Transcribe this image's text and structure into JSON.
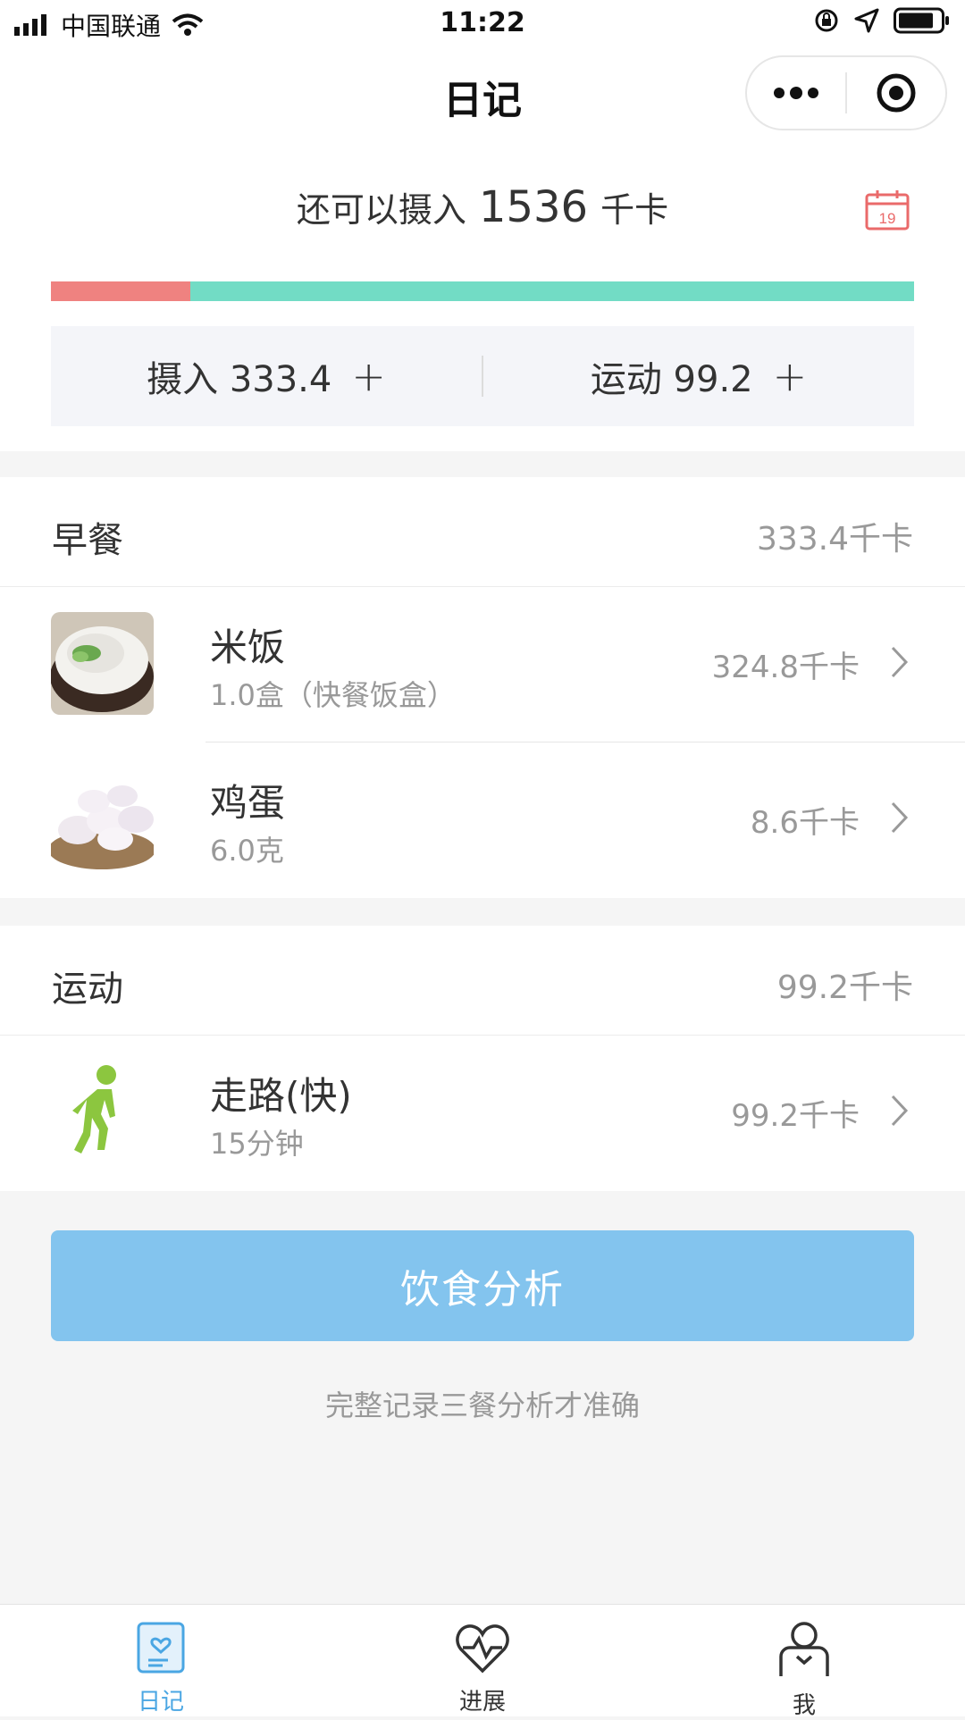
{
  "status_bar": {
    "carrier": "中国联通",
    "time": "11:22"
  },
  "nav": {
    "title": "日记",
    "more_icon": "more-dots-icon",
    "target_icon": "target-icon"
  },
  "summary": {
    "remaining_prefix": "还可以摄入",
    "remaining_value": "1536",
    "remaining_unit": "千卡",
    "calendar_day": "19",
    "progress_intake_fraction": 0.162,
    "colors": {
      "intake": "#ef8280",
      "remaining": "#72dcc5"
    },
    "intake_label": "摄入 333.4",
    "exercise_label": "运动 99.2",
    "plus": "+"
  },
  "breakfast": {
    "title": "早餐",
    "total": "333.4千卡",
    "items": [
      {
        "name": "米饭",
        "detail": "1.0盒（快餐饭盒）",
        "kcal": "324.8千卡"
      },
      {
        "name": "鸡蛋",
        "detail": "6.0克",
        "kcal": "8.6千卡"
      }
    ]
  },
  "exercise": {
    "title": "运动",
    "total": "99.2千卡",
    "items": [
      {
        "name": "走路(快)",
        "detail": "15分钟",
        "kcal": "99.2千卡"
      }
    ]
  },
  "analyze_button": "饮食分析",
  "hint": "完整记录三餐分析才准确",
  "tabs": [
    {
      "label": "日记",
      "icon": "diary-icon",
      "active": true
    },
    {
      "label": "进展",
      "icon": "heart-pulse-icon",
      "active": false
    },
    {
      "label": "我",
      "icon": "user-icon",
      "active": false
    }
  ]
}
